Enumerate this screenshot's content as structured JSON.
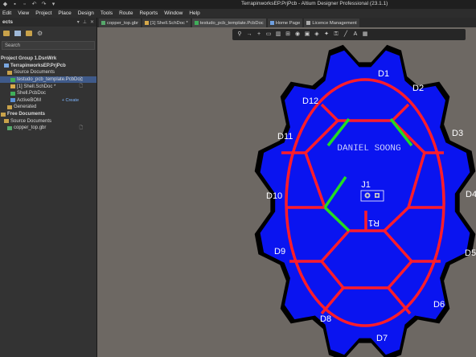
{
  "window": {
    "title": "TerrapinworksEP.PrjPcb - Altium Designer Professional (23.1.1)"
  },
  "menu": [
    "Edit",
    "View",
    "Project",
    "Place",
    "Design",
    "Tools",
    "Route",
    "Reports",
    "Window",
    "Help"
  ],
  "panel": {
    "title": "ects",
    "search_placeholder": "Search",
    "tree": [
      {
        "label": "Project Group 1.DsnWrk",
        "icon": "none",
        "indent": 0,
        "bold": true
      },
      {
        "label": "TerrapinworksEP.PrjPcb",
        "icon": "proj",
        "indent": 1,
        "bold": true
      },
      {
        "label": "Source Documents",
        "icon": "folder",
        "indent": 2
      },
      {
        "label": "testudo_pcb_template.PcbDoc",
        "icon": "pcb",
        "indent": 3,
        "selected": true,
        "mark": "🗋"
      },
      {
        "label": "[1] Shell.SchDoc *",
        "icon": "sch",
        "indent": 3,
        "mark": "🗋"
      },
      {
        "label": "Shell.PcbDoc",
        "icon": "pcb",
        "indent": 3
      },
      {
        "label": "ActiveBOM",
        "icon": "bom",
        "indent": 3,
        "create": "+ Create"
      },
      {
        "label": "Generated",
        "icon": "folder",
        "indent": 2
      },
      {
        "label": "Free Documents",
        "icon": "folder",
        "indent": 0,
        "bold": true
      },
      {
        "label": "Source Documents",
        "icon": "folder",
        "indent": 1
      },
      {
        "label": "copper_top.gbr",
        "icon": "gbr",
        "indent": 2,
        "mark": "🗋"
      }
    ]
  },
  "tabs": [
    {
      "label": "copper_top.gbr",
      "color": "#57a86b"
    },
    {
      "label": "[1] Shell.SchDoc *",
      "color": "#d7a94a"
    },
    {
      "label": "testudo_pcb_template.PcbDoc",
      "color": "#3fae5a",
      "active": true
    },
    {
      "label": "Home Page",
      "color": "#6fa0e0"
    },
    {
      "label": "Licence Management",
      "color": "#aaaaaa"
    }
  ],
  "board": {
    "author_text": "DANIEL SOONG",
    "connector_label": "J1",
    "resistor_label": "R1",
    "diodes": [
      "D1",
      "D2",
      "D3",
      "D4",
      "D5",
      "D6",
      "D7",
      "D8",
      "D9",
      "D10",
      "D11",
      "D12"
    ],
    "colors": {
      "board": "#0a14f0",
      "trace": "#ff1c2a",
      "highlight": "#22dd22",
      "outline": "#000000",
      "silkscreen": "#ffffff"
    }
  }
}
